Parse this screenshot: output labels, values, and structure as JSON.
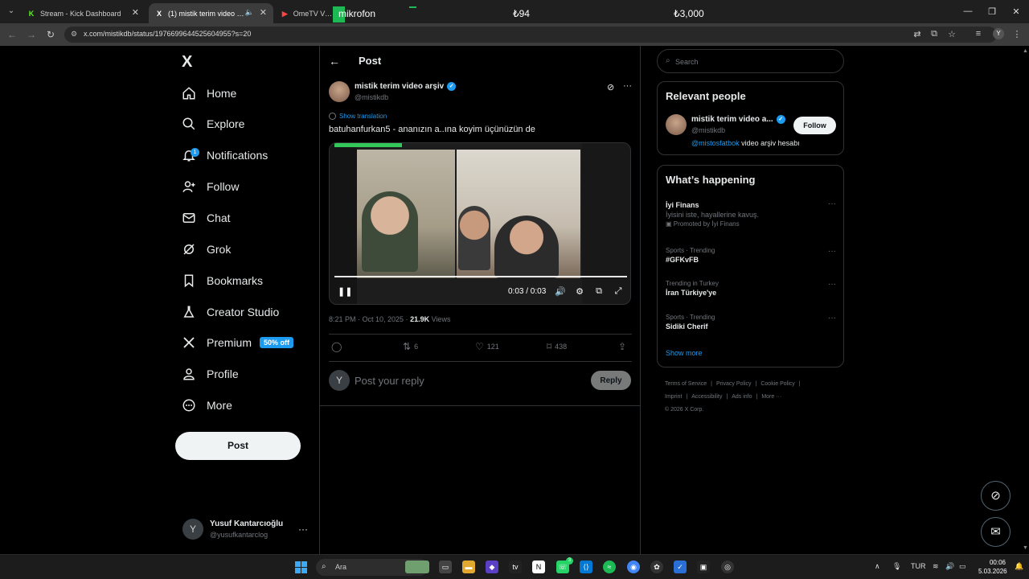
{
  "browser": {
    "tabs": [
      {
        "label": "Stream - Kick Dashboard",
        "fav": "K",
        "fav_color": "#53fc18",
        "active": false
      },
      {
        "label": "(1) mistik terim video arşiv",
        "fav": "X",
        "fav_color": "#ffffff",
        "active": true
      },
      {
        "label": "OmeTV Video",
        "fav": "▶",
        "fav_color": "#ff4444",
        "active": false
      }
    ],
    "overlay_mic": "mikrofon",
    "overlay_amount1": "₺94",
    "overlay_amount2": "₺3,000",
    "url": "x.com/mistikdb/status/1976699644525604955?s=20"
  },
  "sidebar": {
    "logo": "X",
    "items": [
      {
        "label": "Home",
        "icon": "home-icon"
      },
      {
        "label": "Explore",
        "icon": "search-icon"
      },
      {
        "label": "Notifications",
        "icon": "bell-icon",
        "badge": "1"
      },
      {
        "label": "Follow",
        "icon": "person-add-icon"
      },
      {
        "label": "Chat",
        "icon": "envelope-icon"
      },
      {
        "label": "Grok",
        "icon": "grok-icon"
      },
      {
        "label": "Bookmarks",
        "icon": "bookmark-icon"
      },
      {
        "label": "Creator Studio",
        "icon": "flask-icon"
      },
      {
        "label": "Premium",
        "icon": "x-icon",
        "promo": "50% off"
      },
      {
        "label": "Profile",
        "icon": "person-icon"
      },
      {
        "label": "More",
        "icon": "more-circle-icon"
      }
    ],
    "post_button": "Post",
    "account": {
      "initial": "Y",
      "name": "Yusuf Kantarcıoğlu",
      "handle": "@yusufkantarclog"
    }
  },
  "main": {
    "title": "Post",
    "author": {
      "name": "mistik terim video arşiv",
      "handle": "@mistikdb"
    },
    "show_translation": "Show translation",
    "text": "batuhanfurkan5 - ananızın a..ına koyim üçünüzün de",
    "video": {
      "time": "0:03 / 0:03",
      "progress": 1.0
    },
    "meta_time": "8:21 PM · Oct 10, 2025 · ",
    "views_count": "21.9K",
    "views_label": " Views",
    "actions": {
      "reply": "",
      "repost": "6",
      "like": "121",
      "bookmark": "438"
    },
    "reply_placeholder": "Post your reply",
    "reply_initial": "Y",
    "reply_button": "Reply"
  },
  "right": {
    "search_placeholder": "Search",
    "relevant": {
      "title": "Relevant people",
      "name": "mistik terim video a...",
      "handle": "@mistikdb",
      "bio_mention": "@mistosfatbok",
      "bio_rest": " video arşiv hesabı",
      "follow": "Follow"
    },
    "happening": {
      "title": "What’s happening",
      "trends": [
        {
          "context": "",
          "title": "İyi Finans",
          "desc": "İyisini iste, hayallerine kavuş.",
          "promo": "Promoted by İyi Finans"
        },
        {
          "context": "Sports · Trending",
          "title": "#GFKvFB",
          "desc": "",
          "promo": ""
        },
        {
          "context": "Trending in Turkey",
          "title": "İran Türkiye'ye",
          "desc": "",
          "promo": ""
        },
        {
          "context": "Sports · Trending",
          "title": "Sidiki Cherif",
          "desc": "",
          "promo": ""
        }
      ],
      "show_more": "Show more"
    },
    "footer": [
      "Terms of Service",
      "|",
      "Privacy Policy",
      "|",
      "Cookie Policy",
      "|",
      "Imprint",
      "|",
      "Accessibility",
      "|",
      "Ads info",
      "|",
      "More ···",
      "© 2026 X Corp."
    ]
  },
  "taskbar": {
    "search": "Ara",
    "lang": "TUR",
    "time": "00:06",
    "date": "5.03.2026",
    "whatsapp_badge": "3"
  }
}
